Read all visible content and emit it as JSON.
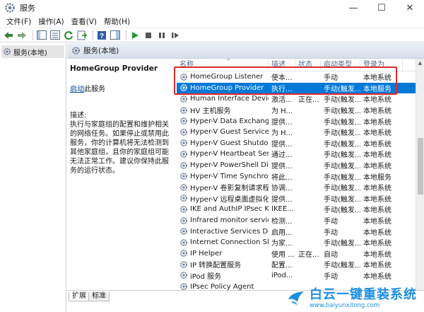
{
  "window": {
    "title": "服务",
    "minimize": "—",
    "maximize": "☐",
    "close": "✕"
  },
  "menu": {
    "items": [
      "文件(F)",
      "操作(A)",
      "查看(V)",
      "帮助(H)"
    ]
  },
  "tree": {
    "root": "服务(本地)"
  },
  "pane": {
    "header": "服务(本地)"
  },
  "detail": {
    "service_name": "HomeGroup Provider",
    "start_link": "启动",
    "start_suffix": "此服务",
    "desc_label": "描述:",
    "desc_text": "执行与家庭组的配置和维护相关的网络任务。如果停止或禁用此服务，你的计算机将无法检测到其他家庭组，且你的家庭组可能无法正常工作。建议你保持此服务的运行状态。"
  },
  "list": {
    "headers": [
      "名称",
      "描述",
      "状态",
      "启动类型",
      "登录为"
    ],
    "rows": [
      [
        "HomeGroup Listener",
        "使本...",
        "",
        "手动",
        "本地系统"
      ],
      [
        "HomeGroup Provider",
        "执行...",
        "",
        "手动(触发...",
        "本地服务"
      ],
      [
        "Human Interface Device ...",
        "激活...",
        "正在...",
        "手动(触发...",
        "本地系统"
      ],
      [
        "HV 主机服务",
        "为 H...",
        "",
        "手动(触发...",
        "本地系统"
      ],
      [
        "Hyper-V Data Exchange ...",
        "提供...",
        "",
        "手动(触发...",
        "本地系统"
      ],
      [
        "Hyper-V Guest Service In...",
        "为 H...",
        "",
        "手动(触发...",
        "本地系统"
      ],
      [
        "Hyper-V Guest Shutdown...",
        "提供...",
        "",
        "手动(触发...",
        "本地系统"
      ],
      [
        "Hyper-V Heartbeat Service",
        "通过...",
        "",
        "手动(触发...",
        "本地系统"
      ],
      [
        "Hyper-V PowerShell Dire...",
        "提供...",
        "",
        "手动(触发...",
        "本地系统"
      ],
      [
        "Hyper-V Time Synchroniz...",
        "将此...",
        "",
        "手动(触发...",
        "本地服务"
      ],
      [
        "Hyper-V 卷影复制请求程序",
        "协调...",
        "",
        "手动(触发...",
        "本地系统"
      ],
      [
        "Hyper-V 远程桌面虚拟化...",
        "提供...",
        "",
        "手动(触发...",
        "本地系统"
      ],
      [
        "IKE and AuthIP IPsec Key...",
        "IKEE...",
        "",
        "手动(触发...",
        "本地系统"
      ],
      [
        "Infrared monitor service",
        "检测...",
        "",
        "手动",
        "本地系统"
      ],
      [
        "Interactive Services Dete...",
        "启用...",
        "",
        "手动",
        "本地系统"
      ],
      [
        "Internet Connection Shari...",
        "为家...",
        "",
        "手动(触发...",
        "本地系统"
      ],
      [
        "IP Helper",
        "使用 ...",
        "正在...",
        "自动",
        "本地系统"
      ],
      [
        "IP 转换配置服务",
        "配置...",
        "",
        "手动(触发...",
        "本地系统"
      ],
      [
        "iPod 服务",
        "iPod...",
        "",
        "手动",
        "本地系统"
      ],
      [
        "IPsec Policy Agent",
        "",
        "",
        "",
        ""
      ]
    ],
    "selected_index": 1
  },
  "tabs": [
    "扩展",
    "标准"
  ],
  "watermark": {
    "title": "白云一键重装系统",
    "url": "www.baiyunxitong.com"
  },
  "colors": {
    "selection": "#0078d7",
    "highlight_box": "#e0292b",
    "link": "#0645ad",
    "watermark": "#1d8fe1"
  }
}
